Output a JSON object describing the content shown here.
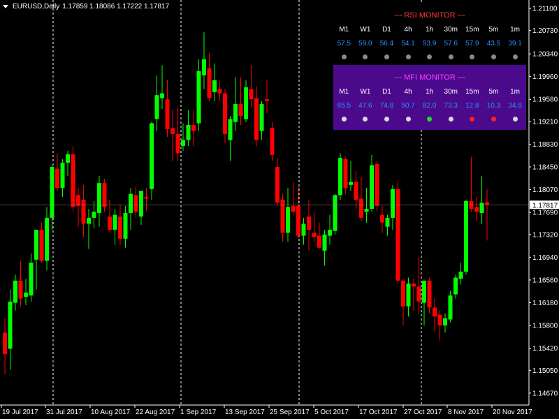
{
  "header": {
    "menu_icon": "triangle-down-icon",
    "symbol": "EURUSD,Daily",
    "ohlc": "1.17859 1.18086 1.17222 1.17817"
  },
  "rsi_panel": {
    "title": "--- RSI MONITOR ---",
    "title_color": "#ff3b3b",
    "bg": "#000000",
    "timeframes": [
      "M1",
      "W1",
      "D1",
      "4h",
      "1h",
      "30m",
      "15m",
      "5m",
      "1m"
    ],
    "values": [
      "57.5",
      "59.0",
      "56.4",
      "54.1",
      "53.9",
      "57.6",
      "57.9",
      "43.5",
      "39.1"
    ],
    "dot_colors": [
      "#8a8a8a",
      "#8a8a8a",
      "#8a8a8a",
      "#8a8a8a",
      "#8a8a8a",
      "#8a8a8a",
      "#8a8a8a",
      "#8a8a8a",
      "#8a8a8a"
    ],
    "value_color": "#2e8fff"
  },
  "mfi_panel": {
    "title": "--- MFI MONITOR ---",
    "title_color": "#ff40ff",
    "bg": "#4b0a8c",
    "timeframes": [
      "M1",
      "W1",
      "D1",
      "4h",
      "1h",
      "30m",
      "15m",
      "5m",
      "1m"
    ],
    "values": [
      "65.5",
      "47.6",
      "74.8",
      "50.7",
      "82.0",
      "73.3",
      "12.8",
      "10.3",
      "34.8"
    ],
    "dot_colors": [
      "#d8d8d8",
      "#d8d8d8",
      "#d8d8d8",
      "#d8d8d8",
      "#22dd22",
      "#d8d8d8",
      "#ff2020",
      "#ff2020",
      "#d8d8d8"
    ],
    "value_color": "#2e8fff"
  },
  "chart_data": {
    "type": "candlestick",
    "symbol": "EURUSD",
    "timeframe": "Daily",
    "ylim": [
      1.1447,
      1.2124
    ],
    "y_ticks": [
      "1.21100",
      "1.20730",
      "1.20340",
      "1.19960",
      "1.19580",
      "1.19210",
      "1.18830",
      "1.18450",
      "1.18070",
      "1.17690",
      "1.17320",
      "1.16940",
      "1.16560",
      "1.16180",
      "1.15800",
      "1.15420",
      "1.15050",
      "1.14670"
    ],
    "x_labels": [
      "19 Jul 2017",
      "31 Jul 2017",
      "10 Aug 2017",
      "22 Aug 2017",
      "1 Sep 2017",
      "13 Sep 2017",
      "25 Sep 2017",
      "5 Oct 2017",
      "17 Oct 2017",
      "27 Oct 2017",
      "8 Nov 2017",
      "20 Nov 2017"
    ],
    "current_price": "1.17817",
    "current_price_value": 1.17817,
    "bull_color": "#00ff00",
    "bear_color": "#ff0000",
    "grid": false,
    "period_separators": true,
    "candles": [
      {
        "o": 1.1568,
        "h": 1.1592,
        "l": 1.1498,
        "c": 1.1532
      },
      {
        "o": 1.1541,
        "h": 1.164,
        "l": 1.1506,
        "c": 1.162
      },
      {
        "o": 1.1618,
        "h": 1.1665,
        "l": 1.1605,
        "c": 1.1655
      },
      {
        "o": 1.1655,
        "h": 1.1688,
        "l": 1.1612,
        "c": 1.1625
      },
      {
        "o": 1.1628,
        "h": 1.1658,
        "l": 1.1614,
        "c": 1.1635
      },
      {
        "o": 1.163,
        "h": 1.17,
        "l": 1.162,
        "c": 1.1685
      },
      {
        "o": 1.169,
        "h": 1.1738,
        "l": 1.164,
        "c": 1.174
      },
      {
        "o": 1.174,
        "h": 1.1752,
        "l": 1.1685,
        "c": 1.1688
      },
      {
        "o": 1.1688,
        "h": 1.1778,
        "l": 1.1672,
        "c": 1.176
      },
      {
        "o": 1.176,
        "h": 1.1848,
        "l": 1.174,
        "c": 1.1845
      },
      {
        "o": 1.1842,
        "h": 1.1868,
        "l": 1.1805,
        "c": 1.181
      },
      {
        "o": 1.181,
        "h": 1.1858,
        "l": 1.1795,
        "c": 1.1852
      },
      {
        "o": 1.1852,
        "h": 1.1872,
        "l": 1.183,
        "c": 1.1866
      },
      {
        "o": 1.1866,
        "h": 1.188,
        "l": 1.177,
        "c": 1.1778
      },
      {
        "o": 1.1798,
        "h": 1.181,
        "l": 1.1745,
        "c": 1.178
      },
      {
        "o": 1.179,
        "h": 1.1815,
        "l": 1.1728,
        "c": 1.175
      },
      {
        "o": 1.175,
        "h": 1.1775,
        "l": 1.1708,
        "c": 1.176
      },
      {
        "o": 1.176,
        "h": 1.1788,
        "l": 1.1742,
        "c": 1.177
      },
      {
        "o": 1.1768,
        "h": 1.183,
        "l": 1.1745,
        "c": 1.1818
      },
      {
        "o": 1.1818,
        "h": 1.1825,
        "l": 1.177,
        "c": 1.1778
      },
      {
        "o": 1.1762,
        "h": 1.179,
        "l": 1.1735,
        "c": 1.174
      },
      {
        "o": 1.174,
        "h": 1.1775,
        "l": 1.1715,
        "c": 1.1765
      },
      {
        "o": 1.1762,
        "h": 1.1782,
        "l": 1.1715,
        "c": 1.1725
      },
      {
        "o": 1.1725,
        "h": 1.178,
        "l": 1.171,
        "c": 1.1768
      },
      {
        "o": 1.1768,
        "h": 1.181,
        "l": 1.174,
        "c": 1.18
      },
      {
        "o": 1.1798,
        "h": 1.1812,
        "l": 1.176,
        "c": 1.177
      },
      {
        "o": 1.1762,
        "h": 1.1805,
        "l": 1.1748,
        "c": 1.1805
      },
      {
        "o": 1.1795,
        "h": 1.181,
        "l": 1.1772,
        "c": 1.1792
      },
      {
        "o": 1.1808,
        "h": 1.192,
        "l": 1.179,
        "c": 1.1918
      },
      {
        "o": 1.1925,
        "h": 1.1998,
        "l": 1.1905,
        "c": 1.1965
      },
      {
        "o": 1.196,
        "h": 1.2015,
        "l": 1.1942,
        "c": 1.1968
      },
      {
        "o": 1.1958,
        "h": 1.199,
        "l": 1.1895,
        "c": 1.1908
      },
      {
        "o": 1.191,
        "h": 1.194,
        "l": 1.1855,
        "c": 1.19
      },
      {
        "o": 1.19,
        "h": 1.1945,
        "l": 1.1855,
        "c": 1.1868
      },
      {
        "o": 1.188,
        "h": 1.1918,
        "l": 1.1872,
        "c": 1.189
      },
      {
        "o": 1.189,
        "h": 1.194,
        "l": 1.188,
        "c": 1.1915
      },
      {
        "o": 1.1915,
        "h": 1.194,
        "l": 1.188,
        "c": 1.1905
      },
      {
        "o": 1.1918,
        "h": 1.2025,
        "l": 1.1905,
        "c": 1.2005
      },
      {
        "o": 1.1998,
        "h": 1.207,
        "l": 1.1975,
        "c": 1.2025
      },
      {
        "o": 1.201,
        "h": 1.2035,
        "l": 1.1955,
        "c": 1.196
      },
      {
        "o": 1.197,
        "h": 1.2018,
        "l": 1.1955,
        "c": 1.199
      },
      {
        "o": 1.1975,
        "h": 1.1988,
        "l": 1.1955,
        "c": 1.1968
      },
      {
        "o": 1.1968,
        "h": 1.1975,
        "l": 1.1885,
        "c": 1.19
      },
      {
        "o": 1.189,
        "h": 1.193,
        "l": 1.1855,
        "c": 1.1925
      },
      {
        "o": 1.192,
        "h": 1.1995,
        "l": 1.1905,
        "c": 1.195
      },
      {
        "o": 1.195,
        "h": 1.1995,
        "l": 1.1915,
        "c": 1.193
      },
      {
        "o": 1.1925,
        "h": 1.199,
        "l": 1.192,
        "c": 1.1978
      },
      {
        "o": 1.1975,
        "h": 1.2015,
        "l": 1.1945,
        "c": 1.1958
      },
      {
        "o": 1.196,
        "h": 1.198,
        "l": 1.188,
        "c": 1.189
      },
      {
        "o": 1.1905,
        "h": 1.1955,
        "l": 1.189,
        "c": 1.195
      },
      {
        "o": 1.1958,
        "h": 1.199,
        "l": 1.1935,
        "c": 1.1955
      },
      {
        "o": 1.191,
        "h": 1.192,
        "l": 1.1855,
        "c": 1.1865
      },
      {
        "o": 1.1845,
        "h": 1.186,
        "l": 1.178,
        "c": 1.1785
      },
      {
        "o": 1.179,
        "h": 1.18,
        "l": 1.172,
        "c": 1.1735
      },
      {
        "o": 1.1735,
        "h": 1.181,
        "l": 1.172,
        "c": 1.1778
      },
      {
        "o": 1.178,
        "h": 1.182,
        "l": 1.1765,
        "c": 1.177
      },
      {
        "o": 1.178,
        "h": 1.1812,
        "l": 1.1725,
        "c": 1.173
      },
      {
        "o": 1.173,
        "h": 1.176,
        "l": 1.1715,
        "c": 1.175
      },
      {
        "o": 1.1762,
        "h": 1.179,
        "l": 1.1705,
        "c": 1.174
      },
      {
        "o": 1.1735,
        "h": 1.177,
        "l": 1.172,
        "c": 1.1728
      },
      {
        "o": 1.173,
        "h": 1.1752,
        "l": 1.1708,
        "c": 1.171
      },
      {
        "o": 1.1705,
        "h": 1.174,
        "l": 1.168,
        "c": 1.1732
      },
      {
        "o": 1.173,
        "h": 1.1765,
        "l": 1.1715,
        "c": 1.174
      },
      {
        "o": 1.1738,
        "h": 1.18,
        "l": 1.1732,
        "c": 1.1798
      },
      {
        "o": 1.1798,
        "h": 1.1868,
        "l": 1.179,
        "c": 1.186
      },
      {
        "o": 1.1858,
        "h": 1.1862,
        "l": 1.18,
        "c": 1.181
      },
      {
        "o": 1.1815,
        "h": 1.1855,
        "l": 1.1805,
        "c": 1.182
      },
      {
        "o": 1.182,
        "h": 1.1838,
        "l": 1.1775,
        "c": 1.179
      },
      {
        "o": 1.1792,
        "h": 1.1828,
        "l": 1.1755,
        "c": 1.176
      },
      {
        "o": 1.177,
        "h": 1.181,
        "l": 1.1752,
        "c": 1.1775
      },
      {
        "o": 1.1775,
        "h": 1.1865,
        "l": 1.177,
        "c": 1.1848
      },
      {
        "o": 1.185,
        "h": 1.1855,
        "l": 1.177,
        "c": 1.178
      },
      {
        "o": 1.1765,
        "h": 1.178,
        "l": 1.1735,
        "c": 1.1752
      },
      {
        "o": 1.1745,
        "h": 1.1765,
        "l": 1.173,
        "c": 1.176
      },
      {
        "o": 1.176,
        "h": 1.1815,
        "l": 1.174,
        "c": 1.1808
      },
      {
        "o": 1.1808,
        "h": 1.182,
        "l": 1.165,
        "c": 1.1655
      },
      {
        "o": 1.1655,
        "h": 1.1658,
        "l": 1.158,
        "c": 1.1612
      },
      {
        "o": 1.1612,
        "h": 1.166,
        "l": 1.1595,
        "c": 1.165
      },
      {
        "o": 1.165,
        "h": 1.1658,
        "l": 1.1605,
        "c": 1.1645
      },
      {
        "o": 1.1645,
        "h": 1.1695,
        "l": 1.16,
        "c": 1.162
      },
      {
        "o": 1.1618,
        "h": 1.165,
        "l": 1.158,
        "c": 1.1655
      },
      {
        "o": 1.1655,
        "h": 1.166,
        "l": 1.16,
        "c": 1.161
      },
      {
        "o": 1.161,
        "h": 1.1625,
        "l": 1.157,
        "c": 1.1595
      },
      {
        "o": 1.1598,
        "h": 1.1605,
        "l": 1.1555,
        "c": 1.158
      },
      {
        "o": 1.158,
        "h": 1.16,
        "l": 1.1568,
        "c": 1.1592
      },
      {
        "o": 1.159,
        "h": 1.1638,
        "l": 1.1585,
        "c": 1.163
      },
      {
        "o": 1.1632,
        "h": 1.1665,
        "l": 1.1625,
        "c": 1.166
      },
      {
        "o": 1.1658,
        "h": 1.1685,
        "l": 1.1648,
        "c": 1.167
      },
      {
        "o": 1.167,
        "h": 1.179,
        "l": 1.1665,
        "c": 1.1788
      },
      {
        "o": 1.1788,
        "h": 1.1862,
        "l": 1.177,
        "c": 1.1775
      },
      {
        "o": 1.1778,
        "h": 1.1795,
        "l": 1.1755,
        "c": 1.177
      },
      {
        "o": 1.1768,
        "h": 1.183,
        "l": 1.175,
        "c": 1.1785
      },
      {
        "o": 1.1786,
        "h": 1.1808,
        "l": 1.1722,
        "c": 1.1782
      }
    ]
  }
}
